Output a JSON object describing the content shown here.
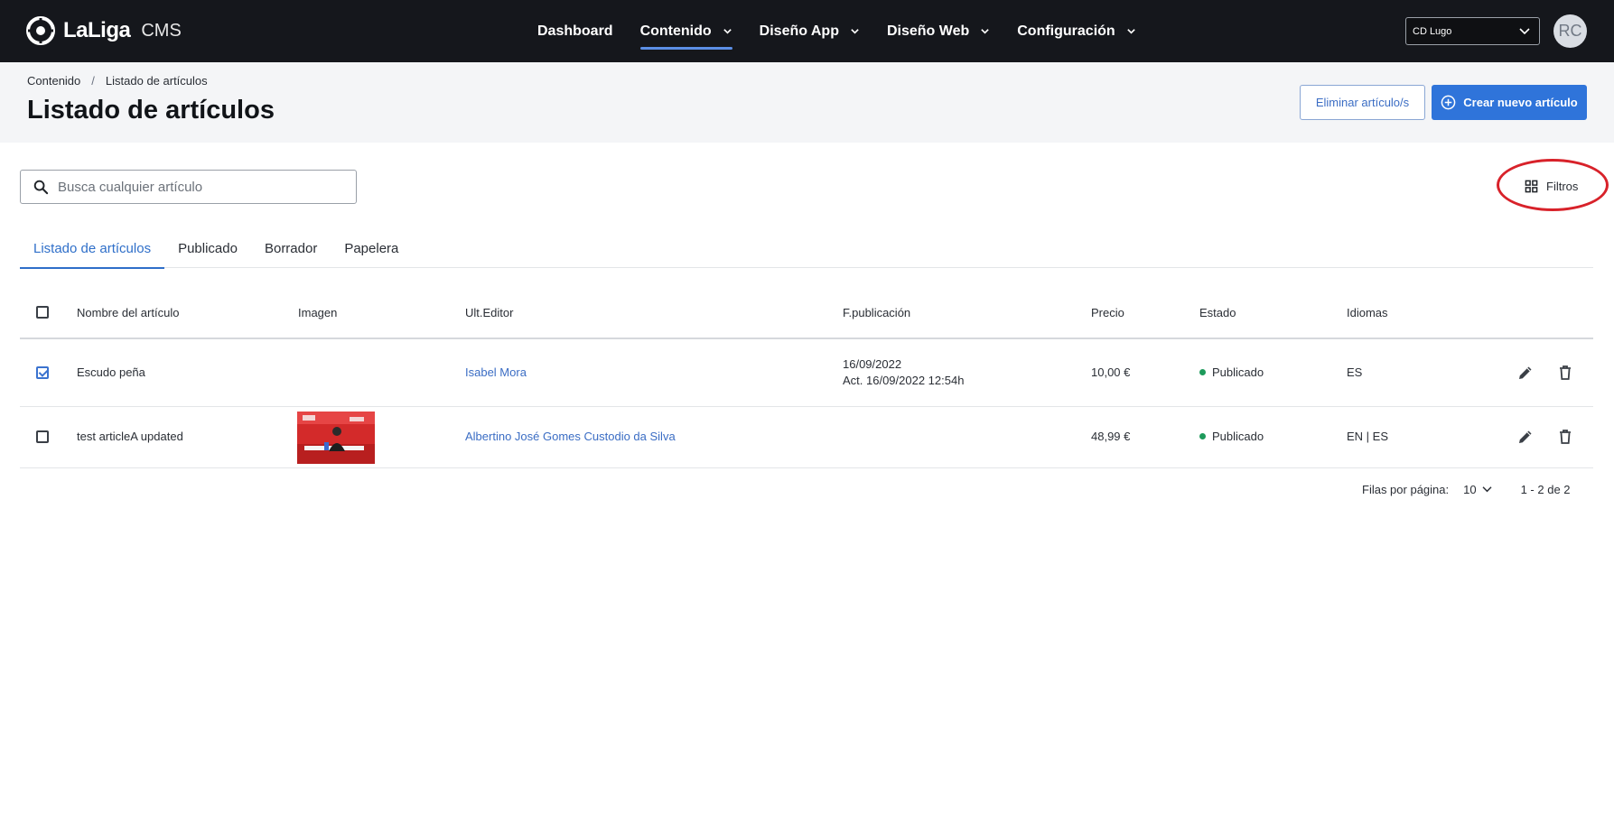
{
  "app": {
    "logo_text": "LaLiga",
    "logo_sub": "CMS"
  },
  "nav": {
    "items": [
      {
        "label": "Dashboard",
        "has_menu": false
      },
      {
        "label": "Contenido",
        "has_menu": true,
        "active": true
      },
      {
        "label": "Diseño App",
        "has_menu": true
      },
      {
        "label": "Diseño Web",
        "has_menu": true
      },
      {
        "label": "Configuración",
        "has_menu": true
      }
    ]
  },
  "club_select": {
    "value": "CD Lugo"
  },
  "user": {
    "initials": "RC"
  },
  "breadcrumb": {
    "parent": "Contenido",
    "separator": "/",
    "current": "Listado de artículos"
  },
  "page": {
    "title": "Listado de artículos"
  },
  "actions": {
    "delete_label": "Eliminar artículo/s",
    "create_label": "Crear nuevo artículo"
  },
  "search": {
    "placeholder": "Busca cualquier artículo",
    "value": ""
  },
  "filters": {
    "label": "Filtros"
  },
  "tabs": [
    {
      "label": "Listado de artículos",
      "active": true
    },
    {
      "label": "Publicado"
    },
    {
      "label": "Borrador"
    },
    {
      "label": "Papelera"
    }
  ],
  "table": {
    "headers": {
      "name": "Nombre del artículo",
      "image": "Imagen",
      "editor": "Ult.Editor",
      "date": "F.publicación",
      "price": "Precio",
      "status": "Estado",
      "languages": "Idiomas"
    },
    "rows": [
      {
        "checked": true,
        "name": "Escudo peña",
        "has_image": false,
        "editor": "Isabel Mora",
        "date": "16/09/2022",
        "updated": "Act. 16/09/2022 12:54h",
        "price": "10,00 €",
        "status": "Publicado",
        "languages": "ES"
      },
      {
        "checked": false,
        "name": "test articleA updated",
        "has_image": true,
        "editor": "Albertino José Gomes Custodio da Silva",
        "date": "",
        "updated": "",
        "price": "48,99 €",
        "status": "Publicado",
        "languages": "EN | ES"
      }
    ]
  },
  "pagination": {
    "rows_per_page_label": "Filas por página:",
    "rows_per_page": "10",
    "range": "1 - 2 de 2"
  },
  "colors": {
    "topbar": "#15171c",
    "primary": "#2f74da",
    "link": "#3b6dc4",
    "status_published": "#1d9a5b",
    "annotation": "#d8222a"
  },
  "icons": {
    "logo": "laliga-ball-icon",
    "search": "search-icon",
    "filters": "grid-icon",
    "create": "plus-circle-icon",
    "edit": "pencil-icon",
    "delete": "trash-icon"
  }
}
